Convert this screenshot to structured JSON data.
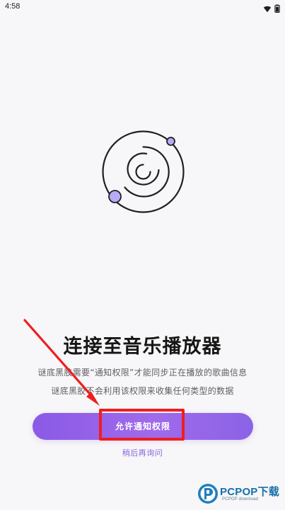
{
  "status_bar": {
    "time": "4:58",
    "wifi_icon": "wifi-icon",
    "battery_icon": "battery-icon"
  },
  "hero": {
    "icon": "music-disc-icon",
    "accent_color": "#b8aaf6",
    "stroke_color": "#202020"
  },
  "main": {
    "title": "连接至音乐播放器",
    "desc_line1": "谜底黑胶需要“通知权限”才能同步正在播放的歌曲信息",
    "desc_line2": "谜底黑胶不会利用该权限来收集任何类型的数据"
  },
  "actions": {
    "allow_button": "允许通知权限",
    "later_link": "稍后再询问"
  },
  "annotation": {
    "arrow_color": "#ef1e1e",
    "box_color": "#ef1e1e"
  },
  "watermark": {
    "brand": "PCPOP下载",
    "sub": "PCPOP download"
  }
}
